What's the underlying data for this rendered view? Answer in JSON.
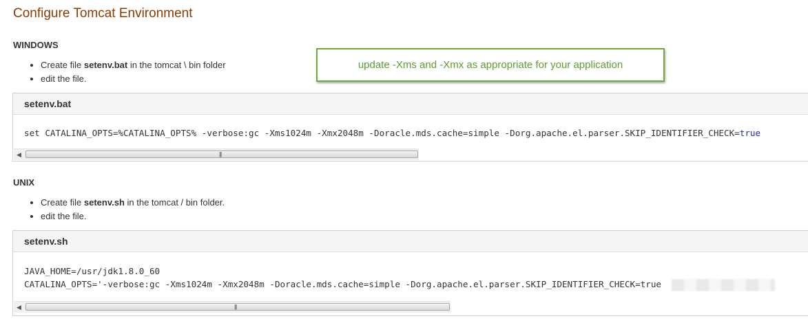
{
  "page": {
    "title": "Configure Tomcat Environment"
  },
  "callout": {
    "text": "update -Xms and -Xmx as appropriate for your application"
  },
  "windows": {
    "heading": "WINDOWS",
    "steps": [
      {
        "prefix": "Create file ",
        "file": "setenv.bat",
        "suffix": " in the tomcat \\ bin folder"
      },
      {
        "text": "edit the file."
      }
    ],
    "code": {
      "filename": "setenv.bat",
      "line_main": "set CATALINA_OPTS=%CATALINA_OPTS% -verbose:gc -Xms1024m -Xmx2048m -Doracle.mds.cache=simple -Dorg.apache.el.parser.SKIP_IDENTIFIER_CHECK=",
      "line_keyword": "true"
    },
    "scroll_arrow": "left-arrow-icon",
    "scroll_grip": "|||"
  },
  "unix": {
    "heading": "UNIX",
    "steps": [
      {
        "prefix": "Create file ",
        "file": "setenv.sh",
        "suffix": " in the tomcat / bin folder."
      },
      {
        "text": "edit the file."
      }
    ],
    "code": {
      "filename": "setenv.sh",
      "line1": "JAVA_HOME=/usr/jdk1.8.0_60",
      "line2": "CATALINA_OPTS='-verbose:gc -Xms1024m -Xmx2048m -Doracle.mds.cache=simple -Dorg.apache.el.parser.SKIP_IDENTIFIER_CHECK=true"
    },
    "scroll_arrow": "left-arrow-icon",
    "scroll_grip": "|||"
  },
  "colors": {
    "title": "#8b3a00",
    "callout_border": "#6aab3a",
    "callout_text": "#5c9c2e",
    "code_keyword": "#1a2fb0"
  }
}
